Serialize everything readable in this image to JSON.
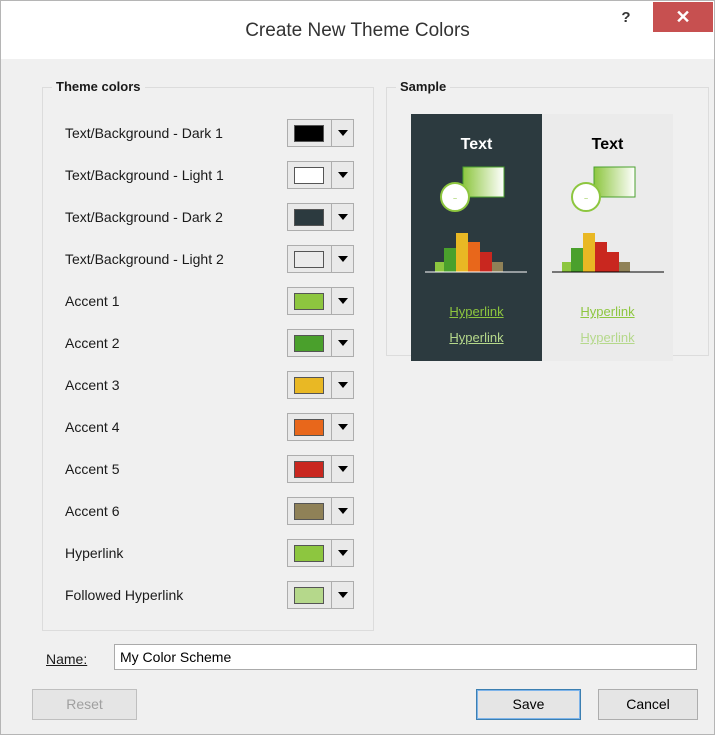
{
  "dialog": {
    "title": "Create New Theme Colors",
    "help_label": "?",
    "close_label": "✕"
  },
  "theme_colors": {
    "legend": "Theme colors",
    "items": [
      {
        "label": "Text/Background - Dark 1",
        "color": "#000000"
      },
      {
        "label": "Text/Background - Light 1",
        "color": "#ffffff"
      },
      {
        "label": "Text/Background - Dark 2",
        "color": "#2c3a3f"
      },
      {
        "label": "Text/Background - Light 2",
        "color": "#ebebeb"
      },
      {
        "label": "Accent 1",
        "color": "#8dc63f"
      },
      {
        "label": "Accent 2",
        "color": "#4aa02c"
      },
      {
        "label": "Accent 3",
        "color": "#e9b824"
      },
      {
        "label": "Accent 4",
        "color": "#e8671b"
      },
      {
        "label": "Accent 5",
        "color": "#c9271f"
      },
      {
        "label": "Accent 6",
        "color": "#8f8157"
      },
      {
        "label": "Hyperlink",
        "color": "#8dc63f"
      },
      {
        "label": "Followed Hyperlink",
        "color": "#b5d88b"
      }
    ]
  },
  "sample": {
    "legend": "Sample",
    "text": "Text",
    "hyperlink": "Hyperlink",
    "followed_hyperlink": "Hyperlink"
  },
  "name_field": {
    "label": "Name:",
    "value": "My Color Scheme"
  },
  "buttons": {
    "reset": "Reset",
    "save": "Save",
    "cancel": "Cancel"
  }
}
